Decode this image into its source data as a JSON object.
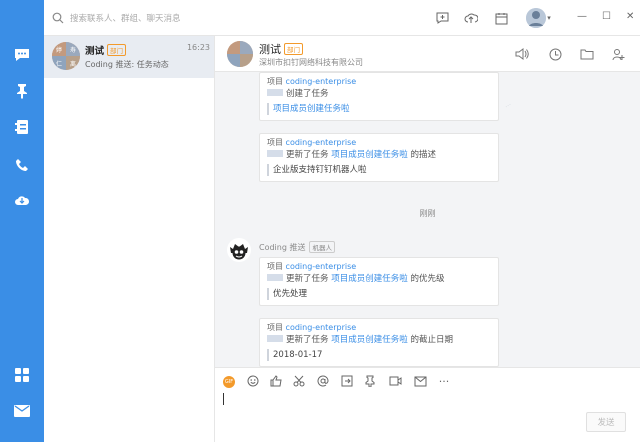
{
  "search": {
    "placeholder": "搜索联系人、群组、聊天消息"
  },
  "rail": {
    "items": [
      "chat-icon",
      "pin-icon",
      "contacts-icon",
      "phone-icon",
      "cloud-icon",
      "apps-icon",
      "mail-icon"
    ]
  },
  "conversation_list": [
    {
      "name": "测试",
      "tag": "部门",
      "time": "16:23",
      "preview": "Coding 推送: 任务动态",
      "avatar_text": [
        "婷",
        "寿",
        "仁",
        "离"
      ]
    }
  ],
  "chat": {
    "title": "测试",
    "tag": "部门",
    "subtitle": "深圳市扣钉网络科技有限公司",
    "time_divider": "刚刚",
    "sender": "Coding 推送",
    "sender_tag": "机器人",
    "messages": [
      {
        "project_prefix": "项目",
        "project": "coding-enterprise",
        "action": "创建了任务",
        "link": "",
        "suffix": "",
        "quote": "项目成员创建任务啦",
        "quote_is_link": true
      },
      {
        "project_prefix": "项目",
        "project": "coding-enterprise",
        "action": "更新了任务",
        "link": "项目成员创建任务啦",
        "suffix": "的描述",
        "quote": "企业版支持钉钉机器人啦",
        "quote_is_link": false
      },
      {
        "project_prefix": "项目",
        "project": "coding-enterprise",
        "action": "更新了任务",
        "link": "项目成员创建任务啦",
        "suffix": "的优先级",
        "quote": "优先处理",
        "quote_is_link": false
      },
      {
        "project_prefix": "项目",
        "project": "coding-enterprise",
        "action": "更新了任务",
        "link": "项目成员创建任务啦",
        "suffix": "的截止日期",
        "quote": "2018-01-17",
        "quote_is_link": false
      }
    ]
  },
  "composer": {
    "gif_label": "GIF",
    "send_label": "发送",
    "value": ""
  },
  "colors": {
    "accent": "#3a8ee6",
    "tag": "#f39a2b"
  }
}
